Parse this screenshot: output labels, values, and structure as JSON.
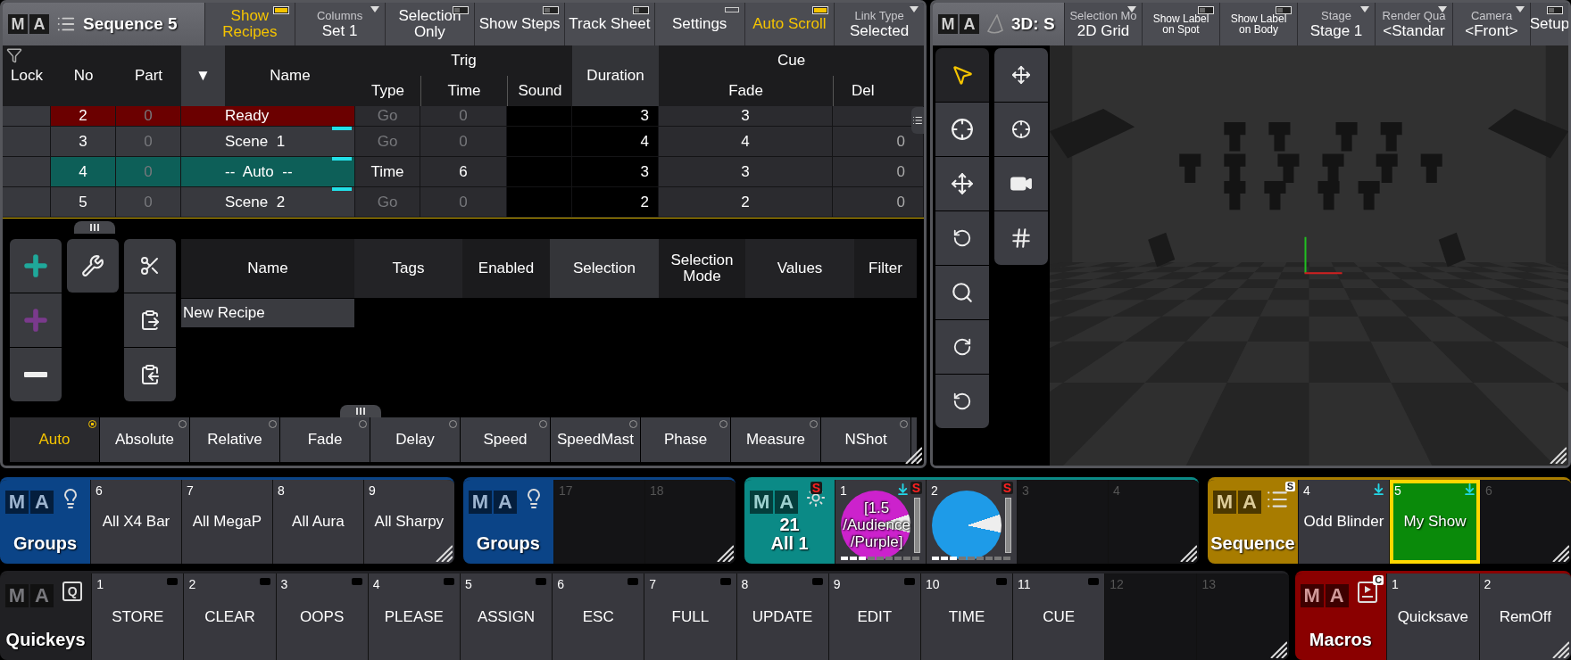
{
  "left_window": {
    "logo": [
      "M",
      "A"
    ],
    "title": "Sequence 5",
    "buttons": [
      {
        "kind": "toggle",
        "label": "Show Recipes",
        "on": true
      },
      {
        "kind": "dropdown",
        "caption": "Columns",
        "value": "Set 1"
      },
      {
        "kind": "toggle",
        "label": "Selection Only",
        "on": false
      },
      {
        "kind": "toggle",
        "label": "Show Steps",
        "on": false
      },
      {
        "kind": "toggle",
        "label": "Track Sheet",
        "on": false
      },
      {
        "kind": "menu",
        "label": "Settings"
      },
      {
        "kind": "toggle",
        "label": "Auto Scroll",
        "on": true
      },
      {
        "kind": "dropdown",
        "caption": "Link Type",
        "value": "Selected"
      }
    ],
    "sequence_table": {
      "header": {
        "lock": "Lock",
        "no": "No",
        "part": "Part",
        "sort": "▼",
        "name": "Name",
        "trig": {
          "label": "Trig",
          "type": "Type",
          "time": "Time",
          "sound": "Sound"
        },
        "duration": "Duration",
        "cue": {
          "label": "Cue",
          "fade": "Fade",
          "delay": "Del"
        }
      },
      "rows": [
        {
          "no": "2",
          "part": "0",
          "name": "Ready",
          "trig_type": "Go",
          "trig_time": "0",
          "duration": "3",
          "fade": "3",
          "trig_dimmed": true,
          "marker": false,
          "color": "#6b0000"
        },
        {
          "no": "3",
          "part": "0",
          "name": "Scene  1",
          "trig_type": "Go",
          "trig_time": "0",
          "duration": "4",
          "fade": "4",
          "delay": "0",
          "trig_dimmed": true,
          "marker": true
        },
        {
          "no": "4",
          "part": "0",
          "name": "--  Auto  --",
          "trig_type": "Time",
          "trig_time": "6",
          "duration": "3",
          "fade": "3",
          "delay": "0",
          "trig_dimmed": false,
          "marker": true,
          "color": "#0d5f58"
        },
        {
          "no": "5",
          "part": "0",
          "name": "Scene  2",
          "trig_type": "Go",
          "trig_time": "0",
          "duration": "2",
          "fade": "2",
          "delay": "0",
          "trig_dimmed": true,
          "marker": true
        }
      ]
    },
    "recipes": {
      "columns": [
        {
          "label": "Name",
          "selected": false
        },
        {
          "label": "Tags",
          "selected": false
        },
        {
          "label": "Enabled",
          "selected": false
        },
        {
          "label": "Selection",
          "selected": true
        },
        {
          "label": "Selection Mode",
          "selected": false
        },
        {
          "label": "Values",
          "selected": false
        },
        {
          "label": "Filter",
          "selected": false
        }
      ],
      "rows": [
        {
          "name": "New Recipe"
        }
      ]
    },
    "modes": [
      {
        "label": "Auto",
        "selected": true
      },
      {
        "label": "Absolute",
        "selected": false
      },
      {
        "label": "Relative",
        "selected": false
      },
      {
        "label": "Fade",
        "selected": false
      },
      {
        "label": "Delay",
        "selected": false
      },
      {
        "label": "Speed",
        "selected": false
      },
      {
        "label": "SpeedMast",
        "selected": false
      },
      {
        "label": "Phase",
        "selected": false
      },
      {
        "label": "Measure",
        "selected": false
      },
      {
        "label": "NShot",
        "selected": false
      }
    ]
  },
  "right_window": {
    "logo": [
      "M",
      "A"
    ],
    "title": "3D: S",
    "buttons": [
      {
        "kind": "dropdown",
        "caption": "Selection Mo",
        "value": "2D Grid"
      },
      {
        "kind": "small_toggle",
        "label": "Show Label on Spot",
        "on": false
      },
      {
        "kind": "small_toggle",
        "label": "Show Label on Body",
        "on": false
      },
      {
        "kind": "dropdown",
        "caption": "Stage",
        "value": "Stage 1"
      },
      {
        "kind": "dropdown",
        "caption": "Render Qua",
        "value": "<Standar"
      },
      {
        "kind": "dropdown",
        "caption": "Camera",
        "value": "<Front>"
      },
      {
        "kind": "toggle",
        "label": "Setup",
        "on": false
      }
    ],
    "tools": {
      "left": [
        {
          "kind": "pointer",
          "selected": true
        },
        {
          "kind": "target",
          "selected": false
        },
        {
          "kind": "move",
          "selected": false
        },
        {
          "kind": "rotate",
          "selected": false
        },
        {
          "kind": "zoom",
          "selected": false
        },
        {
          "kind": "orbit",
          "selected": false
        },
        {
          "kind": "orbit_point",
          "selected": false
        }
      ],
      "right": [
        {
          "kind": "pan",
          "selected": false
        },
        {
          "kind": "pan_center",
          "selected": false
        },
        {
          "kind": "camera",
          "selected": false
        },
        {
          "kind": "grid",
          "selected": false
        }
      ]
    },
    "viewport": {
      "kind": "picture"
    }
  },
  "executor_bars": [
    {
      "blocks": [
        {
          "kind": "groups",
          "logo": [
            "M",
            "A"
          ],
          "title": "Groups",
          "color": "#0b4487",
          "tiles": [
            {
              "kind": "label",
              "number": "6",
              "label": "All X4 Bar",
              "selected": false,
              "loaded": false
            },
            {
              "kind": "label",
              "number": "7",
              "label": "All MegaP",
              "selected": false,
              "loaded": false
            },
            {
              "kind": "label",
              "number": "8",
              "label": "All Aura",
              "selected": false,
              "loaded": false
            },
            {
              "kind": "label",
              "number": "9",
              "label": "All Sharpy",
              "selected": false,
              "loaded": false
            }
          ]
        },
        {
          "kind": "groups",
          "logo": [
            "M",
            "A"
          ],
          "title": "Groups",
          "color": "#0b4487",
          "tiles": [
            {
              "kind": "empty",
              "number": "17"
            },
            {
              "kind": "empty",
              "number": "18"
            }
          ]
        },
        {
          "kind": "preset",
          "logo": [
            "M",
            "A"
          ],
          "number": "21",
          "title": "All 1",
          "badge": "S",
          "color": "#0b8a86",
          "tiles": [
            {
              "kind": "pie",
              "number": "1",
              "label": "[1.5 /Audience /Purple]",
              "color": "#cc22cc",
              "badge": "S",
              "loaded": true
            },
            {
              "kind": "pie",
              "number": "2",
              "color": "#1e9be8",
              "badge": "S",
              "loaded": false
            },
            {
              "kind": "empty",
              "number": "3"
            },
            {
              "kind": "empty",
              "number": "4"
            }
          ]
        },
        {
          "kind": "sequence",
          "logo": [
            "M",
            "A"
          ],
          "title": "Sequence",
          "badge": "S",
          "color": "#a87c00",
          "tiles": [
            {
              "kind": "label",
              "number": "4",
              "label": "Odd Blinder",
              "selected": false,
              "loaded": true
            },
            {
              "kind": "label",
              "number": "5",
              "label": "My Show",
              "selected": true,
              "loaded": true
            },
            {
              "kind": "empty",
              "number": "6"
            }
          ]
        }
      ]
    },
    {
      "blocks": [
        {
          "kind": "quickeys",
          "logo": [
            "M",
            "A"
          ],
          "title": "Quickeys",
          "badge": "Q",
          "color": "#202023",
          "tiles": [
            {
              "kind": "label",
              "number": "1",
              "label": "STORE",
              "selected": false,
              "loaded": false
            },
            {
              "kind": "label",
              "number": "2",
              "label": "CLEAR",
              "selected": false,
              "loaded": false
            },
            {
              "kind": "label",
              "number": "3",
              "label": "OOPS",
              "selected": false,
              "loaded": false
            },
            {
              "kind": "label",
              "number": "4",
              "label": "PLEASE",
              "selected": false,
              "loaded": false
            },
            {
              "kind": "label",
              "number": "5",
              "label": "ASSIGN",
              "selected": false,
              "loaded": false
            },
            {
              "kind": "label",
              "number": "6",
              "label": "ESC",
              "selected": false,
              "loaded": false
            },
            {
              "kind": "label",
              "number": "7",
              "label": "FULL",
              "selected": false,
              "loaded": false
            },
            {
              "kind": "label",
              "number": "8",
              "label": "UPDATE",
              "selected": false,
              "loaded": false
            },
            {
              "kind": "label",
              "number": "9",
              "label": "EDIT",
              "selected": false,
              "loaded": false
            },
            {
              "kind": "label",
              "number": "10",
              "label": "TIME",
              "selected": false,
              "loaded": false
            },
            {
              "kind": "label",
              "number": "11",
              "label": "CUE",
              "selected": false,
              "loaded": false
            },
            {
              "kind": "empty",
              "number": "12"
            },
            {
              "kind": "empty",
              "number": "13"
            }
          ]
        },
        {
          "kind": "macros",
          "logo": [
            "M",
            "A"
          ],
          "title": "Macros",
          "badge": "C",
          "color": "#8a0000",
          "tiles": [
            {
              "kind": "label",
              "number": "1",
              "label": "Quicksave",
              "selected": false,
              "loaded": false
            },
            {
              "kind": "label",
              "number": "2",
              "label": "RemOff",
              "selected": false,
              "loaded": false
            }
          ]
        }
      ]
    }
  ]
}
